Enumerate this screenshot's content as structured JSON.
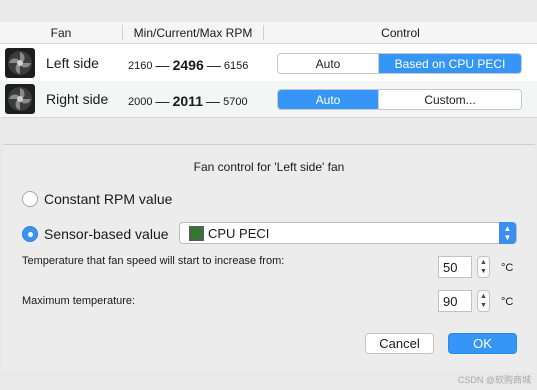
{
  "table": {
    "headers": {
      "fan": "Fan",
      "rpm": "Min/Current/Max RPM",
      "control": "Control"
    },
    "rows": [
      {
        "name": "Left side",
        "min": "2160",
        "current": "2496",
        "max": "6156",
        "dash": "—",
        "options": [
          "Auto",
          "Based on CPU PECI"
        ],
        "selected": "Based on CPU PECI"
      },
      {
        "name": "Right side",
        "min": "2000",
        "current": "2011",
        "max": "5700",
        "dash": "—",
        "options": [
          "Auto",
          "Custom..."
        ],
        "selected": "Auto"
      }
    ]
  },
  "sheet": {
    "title": "Fan control for 'Left side' fan",
    "radio_constant": "Constant RPM value",
    "radio_sensor": "Sensor-based value",
    "selected_mode": "Sensor-based value",
    "sensor_popup": {
      "value": "CPU PECI",
      "icon": "chip-icon"
    },
    "start_temp_label": "Temperature that fan speed will start to increase from:",
    "start_temp_value": "50",
    "max_temp_label": "Maximum temperature:",
    "max_temp_value": "90",
    "unit": "°C",
    "cancel": "Cancel",
    "ok": "OK"
  },
  "colors": {
    "accent": "#3596f7",
    "selected_radio": "#3b94f5"
  },
  "watermark": "CSDN @软购商城"
}
